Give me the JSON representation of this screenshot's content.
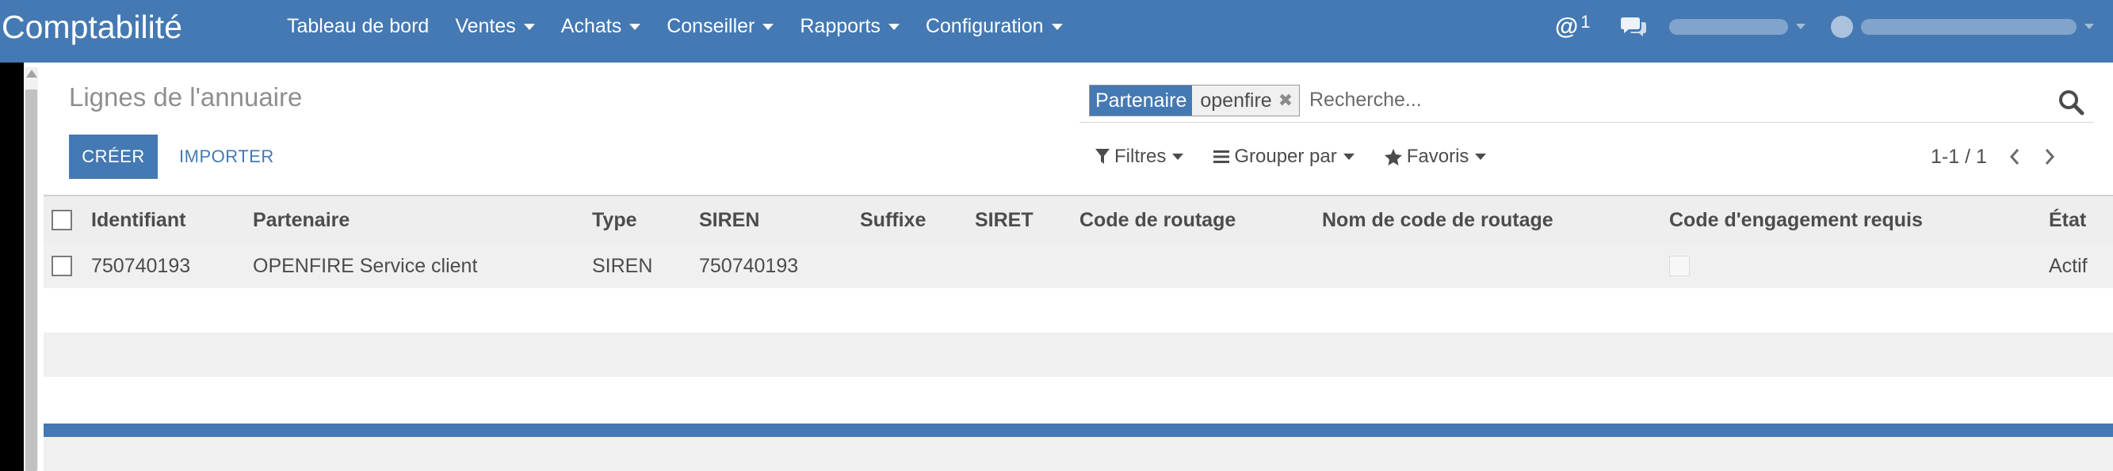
{
  "app": {
    "brand": "Comptabilité"
  },
  "nav": {
    "menus": [
      {
        "label": "Tableau de bord",
        "dropdown": false
      },
      {
        "label": "Ventes",
        "dropdown": true
      },
      {
        "label": "Achats",
        "dropdown": true
      },
      {
        "label": "Conseiller",
        "dropdown": true
      },
      {
        "label": "Rapports",
        "dropdown": true
      },
      {
        "label": "Configuration",
        "dropdown": true
      }
    ],
    "mention_count": "1",
    "icons": [
      "at-icon",
      "chat-icon",
      "company-switcher",
      "user-avatar"
    ]
  },
  "control_panel": {
    "title": "Lignes de l'annuaire",
    "create_label": "CRÉER",
    "import_label": "IMPORTER",
    "search": {
      "facet_label": "Partenaire",
      "facet_value": "openfire",
      "placeholder": "Recherche..."
    },
    "filters_label": "Filtres",
    "groupby_label": "Grouper par",
    "favorites_label": "Favoris",
    "pager": "1-1 / 1"
  },
  "table": {
    "columns": [
      "Identifiant",
      "Partenaire",
      "Type",
      "SIREN",
      "Suffixe",
      "SIRET",
      "Code de routage",
      "Nom de code de routage",
      "Code d'engagement requis",
      "État"
    ],
    "rows": [
      {
        "identifiant": "750740193",
        "partenaire": "OPENFIRE Service client",
        "type": "SIREN",
        "siren": "750740193",
        "suffixe": "",
        "siret": "",
        "code_routage": "",
        "nom_code_routage": "",
        "engagement_requis": false,
        "etat": "Actif"
      }
    ]
  },
  "colors": {
    "primary": "#4479b3",
    "row_stripe": "#f0f0f0",
    "header_bg": "#eeeeee"
  }
}
